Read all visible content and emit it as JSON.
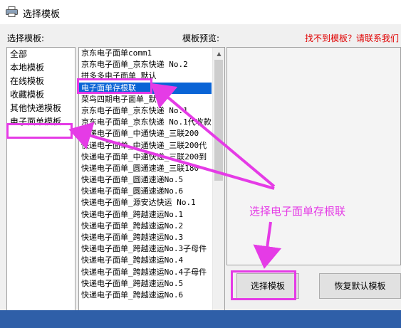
{
  "window": {
    "title": "选择模板",
    "icon": "printer-icon"
  },
  "labels": {
    "category": "选择模板:",
    "preview": "模板预览:",
    "help_link": "找不到模板？请联系我们"
  },
  "categories": [
    {
      "label": "全部"
    },
    {
      "label": "本地模板"
    },
    {
      "label": "在线模板"
    },
    {
      "label": "收藏模板"
    },
    {
      "label": "其他快递模板"
    },
    {
      "label": "电子面单模板"
    }
  ],
  "templates": [
    "京东电子面单comm1",
    "京东电子面单_京东快递 No.2",
    "拼多多电子面单_默认",
    "电子面单存根联",
    "菜鸟四期电子面单_默认",
    "京东电子面单_京东快递 No.1",
    "京东电子面单_京东快递 No.1代收款",
    "快递电子面单_中通快递_三联200",
    "快递电子面单_中通快递_三联200代",
    "快递电子面单_中通快递_三联200到",
    "快递电子面单_圆通速递_三联180",
    "快递电子面单_圆通速递No.5",
    "快递电子面单_圆通速递No.6",
    "快递电子面单_源安达快运 No.1",
    "快递电子面单_跨越速运No.1",
    "快递电子面单_跨越速运No.2",
    "快递电子面单_跨越速运No.3",
    "快递电子面单_跨越速运No.3子母件",
    "快递电子面单_跨越速运No.4",
    "快递电子面单_跨越速运No.4子母件",
    "快递电子面单_跨越速运No.5",
    "快递电子面单_跨越速运No.6"
  ],
  "selected_template": 3,
  "buttons": {
    "select": "选择模板",
    "restore": "恢复默认模板"
  },
  "annotation": {
    "text": "选择电子面单存根联"
  },
  "colors": {
    "highlight": "#e53be6",
    "selection": "#0a64d6",
    "link": "#e00000",
    "taskbar": "#2f5fa8"
  }
}
